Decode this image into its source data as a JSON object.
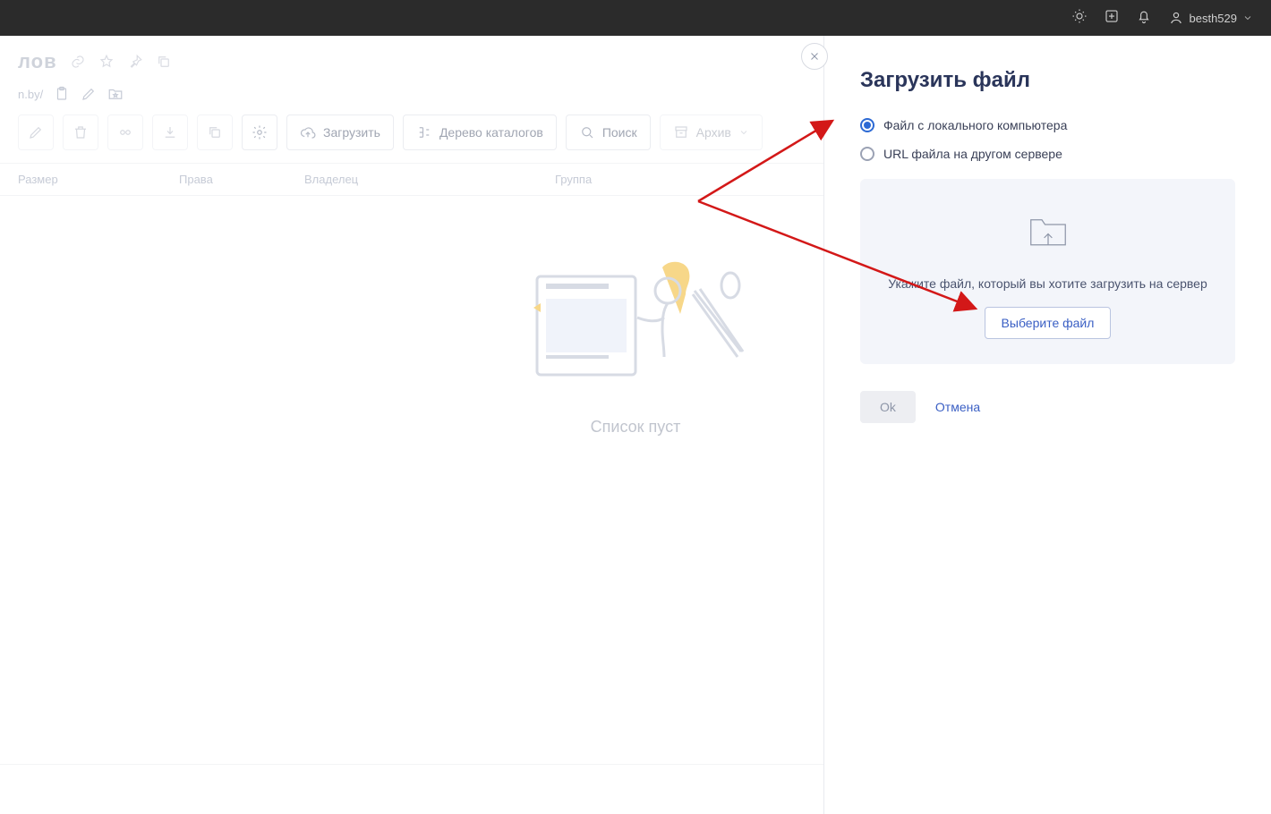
{
  "topbar": {
    "username": "besth529"
  },
  "page": {
    "title_suffix": "лов",
    "path_suffix": "n.by/",
    "toolbar": {
      "upload": "Загрузить",
      "tree": "Дерево каталогов",
      "search": "Поиск",
      "archive": "Архив"
    },
    "table": {
      "col_size": "Размер",
      "col_perms": "Права",
      "col_owner": "Владелец",
      "col_group": "Группа"
    },
    "empty_message": "Список пуст"
  },
  "panel": {
    "title": "Загрузить файл",
    "radio_local": "Файл с локального компьютера",
    "radio_url": "URL файла на другом сервере",
    "dropzone_hint": "Укажите файл, который вы хотите загрузить на сервер",
    "choose_file": "Выберите файл",
    "ok": "Ok",
    "cancel": "Отмена"
  }
}
